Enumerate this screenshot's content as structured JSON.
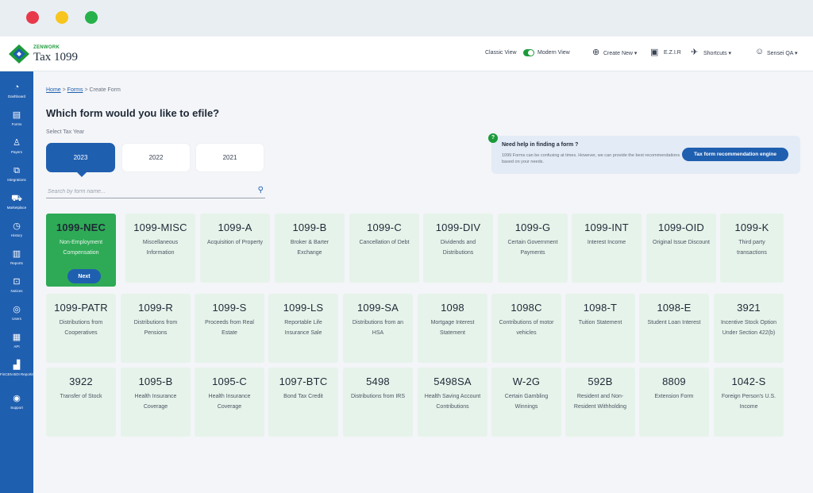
{
  "window": {
    "controls": [
      "close",
      "minimize",
      "maximize"
    ]
  },
  "brand": {
    "company": "ZENWORK",
    "product": "Tax 1099"
  },
  "topbar": {
    "classic_view": "Classic View",
    "modern_view": "Modern View",
    "create_new": "Create New ▾",
    "ezi": "E.Z.I.R",
    "shortcuts": "Shortcuts ▾",
    "user": "Sensei QA ▾"
  },
  "sidebar": {
    "items": [
      {
        "label": "Dashboard",
        "icon": "dashboard-icon"
      },
      {
        "label": "Forms",
        "icon": "forms-icon"
      },
      {
        "label": "Payers",
        "icon": "payers-icon"
      },
      {
        "label": "Integrations",
        "icon": "integrations-icon"
      },
      {
        "label": "Marketplace",
        "icon": "cart-icon"
      },
      {
        "label": "History",
        "icon": "history-icon"
      },
      {
        "label": "Reports",
        "icon": "reports-icon"
      },
      {
        "label": "Notices",
        "icon": "notices-icon"
      },
      {
        "label": "Users",
        "icon": "users-icon"
      },
      {
        "label": "API",
        "icon": "api-icon"
      },
      {
        "label": "FinCEN BOI Reporting",
        "icon": "boi-icon"
      },
      {
        "label": "Support",
        "icon": "support-icon"
      }
    ]
  },
  "breadcrumb": {
    "home": "Home",
    "forms": "Forms",
    "current": "Create Form",
    "sep": " > "
  },
  "page": {
    "title": "Which form would you like to efile?",
    "year_label": "Select Tax Year"
  },
  "years": [
    "2023",
    "2022",
    "2021"
  ],
  "search": {
    "placeholder": "Search by form name..."
  },
  "help": {
    "badge": "?",
    "title": "Need help in finding a form ?",
    "body": "1099 Forms can be confusing at times. However, we can provide the best recommendations based on your needs.",
    "button": "Tax form recommendation engine"
  },
  "next_label": "Next",
  "forms": [
    {
      "code": "1099-NEC",
      "desc": "Non-Employment Compensation",
      "selected": true
    },
    {
      "code": "1099-MISC",
      "desc": "Miscellaneous Information"
    },
    {
      "code": "1099-A",
      "desc": "Acquisition of Property"
    },
    {
      "code": "1099-B",
      "desc": "Broker & Barter Exchange"
    },
    {
      "code": "1099-C",
      "desc": "Cancellation of Debt"
    },
    {
      "code": "1099-DIV",
      "desc": "Dividends and Distributions"
    },
    {
      "code": "1099-G",
      "desc": "Certain Government Payments"
    },
    {
      "code": "1099-INT",
      "desc": "Interest Income"
    },
    {
      "code": "1099-OID",
      "desc": "Original Issue Discount"
    },
    {
      "code": "1099-K",
      "desc": "Third party transactions"
    },
    {
      "code": "1099-PATR",
      "desc": "Distributions from Cooperatives"
    },
    {
      "code": "1099-R",
      "desc": "Distributions from Pensions"
    },
    {
      "code": "1099-S",
      "desc": "Proceeds from Real Estate"
    },
    {
      "code": "1099-LS",
      "desc": "Reportable Life Insurance Sale"
    },
    {
      "code": "1099-SA",
      "desc": "Distributions from an HSA"
    },
    {
      "code": "1098",
      "desc": "Mortgage Interest Statement"
    },
    {
      "code": "1098C",
      "desc": "Contributions of motor vehicles"
    },
    {
      "code": "1098-T",
      "desc": "Tuition Statement"
    },
    {
      "code": "1098-E",
      "desc": "Student Loan Interest"
    },
    {
      "code": "3921",
      "desc": "Incentive Stock Option Under Section 422(b)"
    },
    {
      "code": "3922",
      "desc": "Transfer of Stock"
    },
    {
      "code": "1095-B",
      "desc": "Health Insurance Coverage"
    },
    {
      "code": "1095-C",
      "desc": "Health Insurance Coverage"
    },
    {
      "code": "1097-BTC",
      "desc": "Bond Tax Credit"
    },
    {
      "code": "5498",
      "desc": "Distributions from IRS"
    },
    {
      "code": "5498SA",
      "desc": "Health Saving Account Contributions"
    },
    {
      "code": "W-2G",
      "desc": "Certain Gambling Winnings"
    },
    {
      "code": "592B",
      "desc": "Resident and Non-Resident Withholding"
    },
    {
      "code": "8809",
      "desc": "Extension Form"
    },
    {
      "code": "1042-S",
      "desc": "Foreign Person's U.S. Income"
    }
  ],
  "colors": {
    "primary": "#1f5fb0",
    "accent": "#2eaa56",
    "card": "#e6f3ea"
  }
}
